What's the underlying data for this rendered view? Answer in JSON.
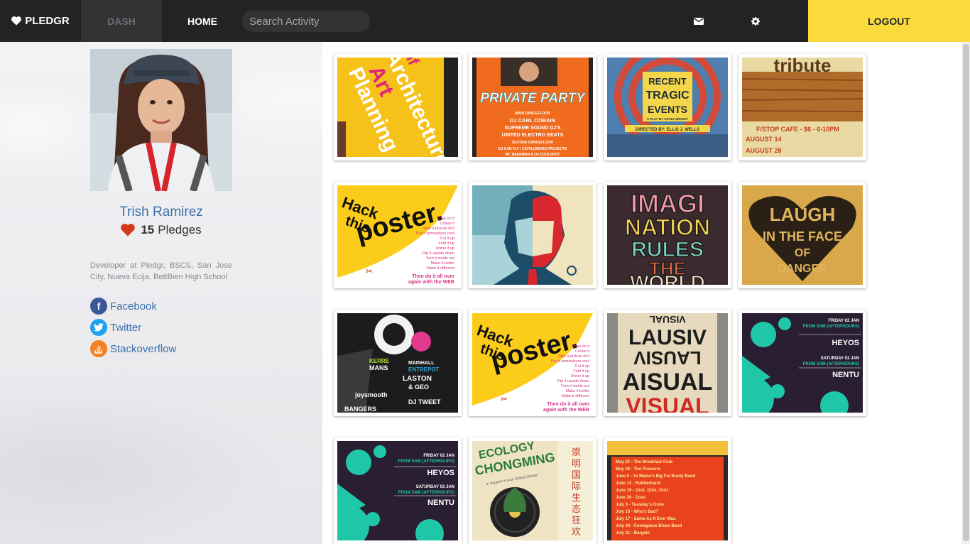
{
  "nav": {
    "brand": "PLEDGR",
    "dash": "DASH",
    "home": "HOME",
    "search_placeholder": "Search Activity",
    "mail_icon": "mail-icon",
    "settings_icon": "gear-icon",
    "logout": "LOGOUT",
    "accent_color": "#fbdb3b"
  },
  "profile": {
    "name": "Trish Ramirez",
    "pledge_count": "15",
    "pledge_label": "Pledges",
    "bio": "Developer at Pledgr, BSCS, San Jose City, Nueva Ecija, BettBien High School",
    "links": [
      {
        "label": "Facebook",
        "icon": "facebook-icon",
        "color": "#3b5998"
      },
      {
        "label": "Twitter",
        "icon": "twitter-icon",
        "color": "#1da1f2"
      },
      {
        "label": "Stackoverflow",
        "icon": "stackoverflow-icon",
        "color": "#f48024"
      }
    ]
  },
  "posters": [
    {
      "title": "Art Architecture Planning"
    },
    {
      "title": "PRIVATE PARTY",
      "lines": [
        "MAIN DANCEFLOOR",
        "DJ CARL COBAIN",
        "SUPREME SOUND DJ'S",
        "UNITED ELECTRO BEATS",
        "SECOND DANCEFLOOR",
        "DJ CAN FLY / CATFLOWERS PROJECTS",
        "MC BEERMAN & DJ COOLSPOT"
      ]
    },
    {
      "title": "RECENT TRAGIC EVENTS",
      "subtitle": "A PLAY BY CRAIG WRIGHT",
      "directed": "DIRECTED BY: ELLIS J. WELLS"
    },
    {
      "title": "tribute",
      "lines": [
        "F/STOP CAFE - $6 - 6-10PM",
        "AUGUST 14",
        "AUGUST 28"
      ]
    },
    {
      "title": "Hack this poster",
      "lines": [
        "Draw on it",
        "Colour it",
        "Take a picture of it",
        "Put it somewhere cool",
        "Cut it up",
        "Fold it up",
        "Dress it up",
        "Flip it upside down",
        "Turn it inside out",
        "Make it better",
        "Make it different",
        "Then do it all over again with the WEB"
      ]
    },
    {
      "title": "Obama portrait"
    },
    {
      "title": "IMAGINATION RULES THE WORLD"
    },
    {
      "title": "LAUGH IN THE FACE OF DANGER"
    },
    {
      "title": "Club night",
      "lines": [
        "MAINHALL",
        "ENTREPOT",
        "LASTON & GEO",
        "DJ TWEET"
      ]
    },
    {
      "title": "Hack this poster",
      "lines": [
        "Draw on it",
        "Colour it",
        "Take a picture of it",
        "Put it somewhere cool",
        "Cut it up",
        "Fold it up",
        "Dress it up",
        "Flip it upside down",
        "Turn it inside out",
        "Make it better",
        "Make it different",
        "Then do it all over again with the WEB"
      ]
    },
    {
      "title": "VISUAL",
      "lines": [
        "LAUSIV",
        "AISUAL",
        "LAUSIA"
      ]
    },
    {
      "title": "HEYOS / NENTU",
      "lines": [
        "FRIDAY 02 JAN",
        "FROM 5AM (AFTERHOURS)",
        "HEYOS",
        "SATURDAY 03 JAN",
        "NENTU"
      ]
    },
    {
      "title": "HEYOS / NENTU",
      "lines": [
        "FRIDAY 02 JAN",
        "FROM 5AM (AFTERHOURS)",
        "HEYOS",
        "SATURDAY 03 JAN",
        "NENTU"
      ]
    },
    {
      "title": "ECOLOGY CHONGMING",
      "subtitle": "in Support of your Global Climate"
    },
    {
      "title": "Concert schedule",
      "lines": [
        "May 22 - The Breakfast Club",
        "May 29 - The Pioneers",
        "June 5 - Yo Mama's Big Fat Booty Band",
        "June 12 - Rubberband",
        "June 19 - Girlz, Girlz, Girlz",
        "June 26 - Zoso",
        "July 3 - Tuesday's Gone",
        "July 10 - Who's Bad?",
        "July 17 - Same As It Ever Was",
        "July 24 - Contagious Blues Band",
        "July 31 - Bargain"
      ]
    }
  ]
}
